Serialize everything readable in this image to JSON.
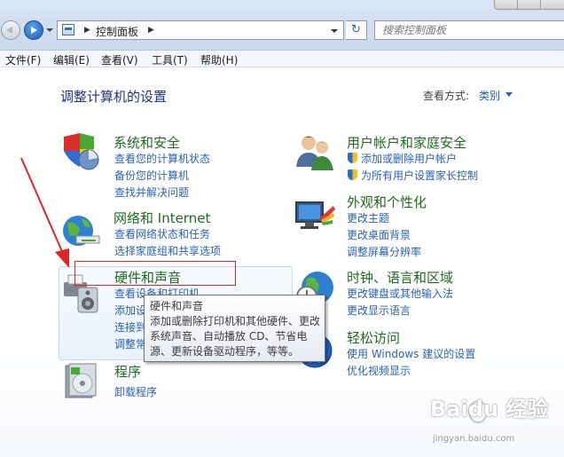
{
  "address_bar": {
    "breadcrumb": "控制面板",
    "search_placeholder": "搜索控制面板"
  },
  "menu": {
    "items": [
      "文件(F)",
      "编辑(E)",
      "查看(V)",
      "工具(T)",
      "帮助(H)"
    ]
  },
  "header": {
    "title": "调整计算机的设置",
    "view_by_label": "查看方式:",
    "view_by_value": "类别"
  },
  "categories": {
    "system_security": {
      "title": "系统和安全",
      "links": [
        "查看您的计算机状态",
        "备份您的计算机",
        "查找并解决问题"
      ]
    },
    "network": {
      "title": "网络和 Internet",
      "links": [
        "查看网络状态和任务",
        "选择家庭组和共享选项"
      ]
    },
    "hardware": {
      "title": "硬件和声音",
      "links": [
        "查看设备和打印机",
        "添加设",
        "连接到",
        "调整常"
      ]
    },
    "programs": {
      "title": "程序",
      "links": [
        "卸载程序"
      ]
    },
    "user_accounts": {
      "title": "用户帐户和家庭安全",
      "links": [
        "添加或删除用户帐户",
        "为所有用户设置家长控制"
      ]
    },
    "appearance": {
      "title": "外观和个性化",
      "links": [
        "更改主题",
        "更改桌面背景",
        "调整屏幕分辨率"
      ]
    },
    "clock": {
      "title": "时钟、语言和区域",
      "links": [
        "更改键盘或其他输入法",
        "更改显示语言"
      ]
    },
    "ease": {
      "title": "轻松访问",
      "links": [
        "使用 Windows 建议的设置",
        "优化视频显示"
      ]
    }
  },
  "tooltip": {
    "title": "硬件和声音",
    "description": "添加或删除打印机和其他硬件、更改系统声音、自动播放 CD、节省电源、更新设备驱动程序，等等。"
  },
  "watermark": {
    "text": "Baidu 经验",
    "url": "jingyan.baidu.com"
  },
  "colors": {
    "category_title": "#1e6b1e",
    "link": "#2a62b8",
    "page_title": "#1e3287",
    "annotation": "#e02525"
  }
}
